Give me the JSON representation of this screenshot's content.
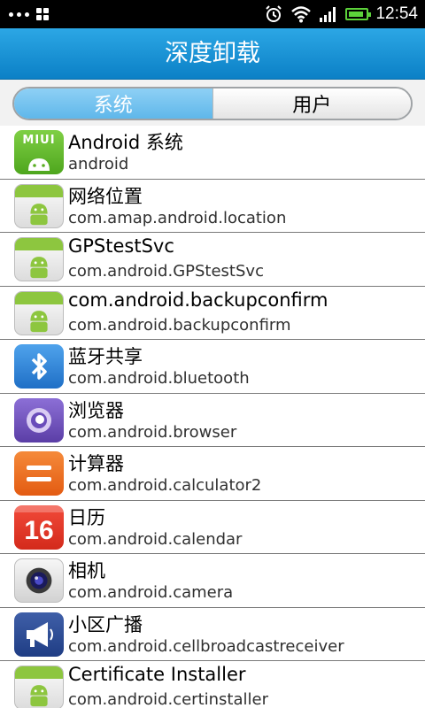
{
  "status_bar": {
    "time": "12:54",
    "icons": [
      "more-dots-icon",
      "grid-icon",
      "alarm-icon",
      "wifi-icon",
      "signal-icon",
      "battery-icon"
    ],
    "battery_level": 0.9
  },
  "header": {
    "title": "深度卸载"
  },
  "tabs": [
    {
      "label": "系统",
      "selected": true
    },
    {
      "label": "用户",
      "selected": false
    }
  ],
  "apps": [
    {
      "name": "Android 系统",
      "package": "android",
      "icon": "miui-icon",
      "icon_label": "MIUI"
    },
    {
      "name": "网络位置",
      "package": "com.amap.android.location",
      "icon": "android-robot-icon"
    },
    {
      "name": "GPStestSvc",
      "package": "com.android.GPStestSvc",
      "icon": "android-robot-icon"
    },
    {
      "name": "com.android.backupconfirm",
      "package": "com.android.backupconfirm",
      "icon": "android-robot-icon"
    },
    {
      "name": "蓝牙共享",
      "package": "com.android.bluetooth",
      "icon": "bluetooth-icon"
    },
    {
      "name": "浏览器",
      "package": "com.android.browser",
      "icon": "browser-icon"
    },
    {
      "name": "计算器",
      "package": "com.android.calculator2",
      "icon": "calculator-icon"
    },
    {
      "name": "日历",
      "package": "com.android.calendar",
      "icon": "calendar-icon",
      "icon_label": "16"
    },
    {
      "name": "相机",
      "package": "com.android.camera",
      "icon": "camera-icon"
    },
    {
      "name": "小区广播",
      "package": "com.android.cellbroadcastreceiver",
      "icon": "megaphone-icon"
    },
    {
      "name": "Certificate Installer",
      "package": "com.android.certinstaller",
      "icon": "android-robot-icon"
    }
  ],
  "colors": {
    "header_blue": "#1a93d6",
    "tab_active": "#7ac6f0",
    "status_bar": "#000000",
    "battery_green": "#5cd23a"
  }
}
